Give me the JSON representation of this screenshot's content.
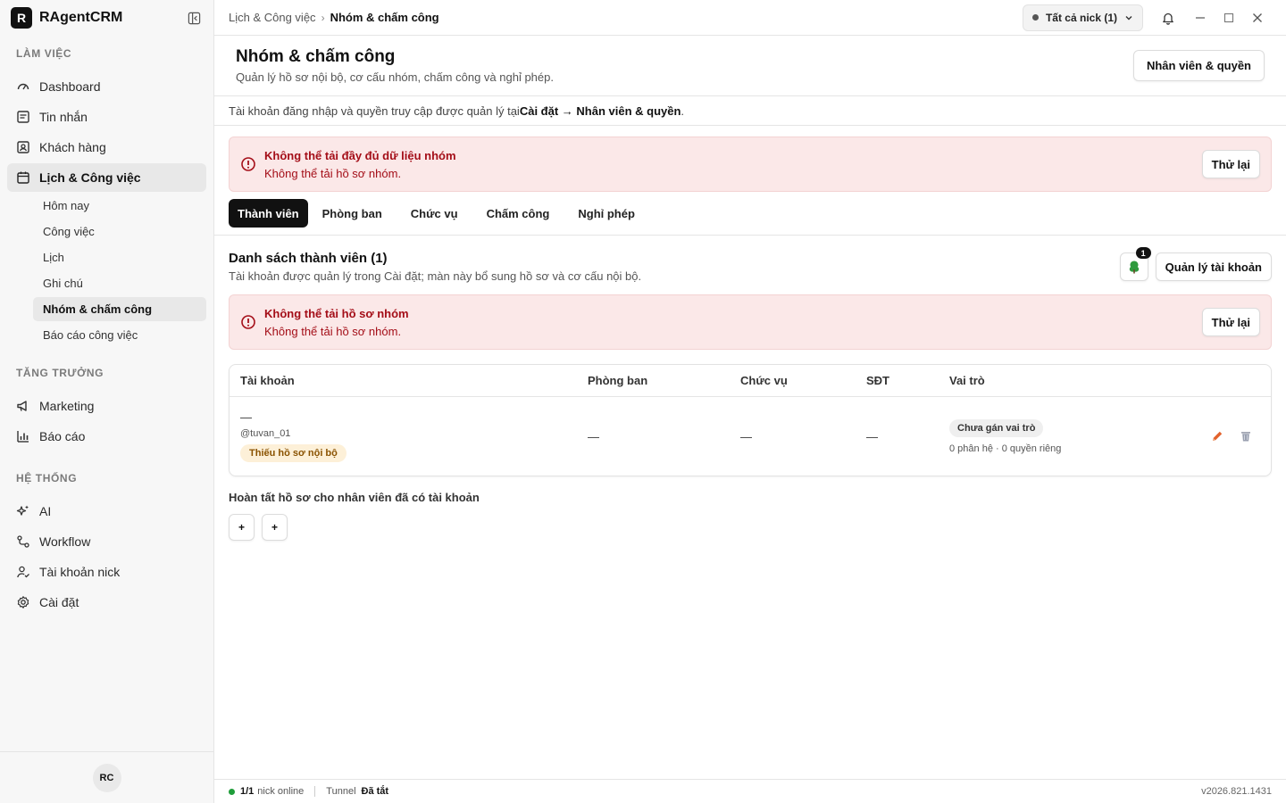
{
  "app": {
    "logo_letter": "R",
    "name": "RAgentCRM"
  },
  "sidebar": {
    "sections": [
      {
        "title": "LÀM VIỆC"
      },
      {
        "title": "TĂNG TRƯỞNG"
      },
      {
        "title": "HỆ THỐNG"
      }
    ],
    "items": {
      "dashboard": "Dashboard",
      "messages": "Tin nhắn",
      "customers": "Khách hàng",
      "schedule": "Lịch & Công việc",
      "marketing": "Marketing",
      "reports": "Báo cáo",
      "ai": "AI",
      "workflow": "Workflow",
      "nick_accounts": "Tài khoản nick",
      "settings": "Cài đặt"
    },
    "sub_items": {
      "today": "Hôm nay",
      "tasks": "Công việc",
      "calendar": "Lịch",
      "notes": "Ghi chú",
      "team": "Nhóm & chấm công",
      "work_report": "Báo cáo công việc"
    },
    "avatar_initials": "RC"
  },
  "topbar": {
    "breadcrumb_parent": "Lịch & Công việc",
    "breadcrumb_sep": "›",
    "breadcrumb_current": "Nhóm & chấm công",
    "nick_filter": "Tất cả nick (1)"
  },
  "page": {
    "title": "Nhóm & chấm công",
    "subtitle": "Quản lý hồ sơ nội bộ, cơ cấu nhóm, chấm công và nghỉ phép.",
    "header_button": "Nhân viên & quyền",
    "info_prefix": "Tài khoản đăng nhập và quyền truy cập được quản lý tại ",
    "info_link": "Cài đặt → Nhân viên & quyền",
    "info_suffix": "."
  },
  "alerts": {
    "top": {
      "title": "Không thể tải đầy đủ dữ liệu nhóm",
      "desc": "Không thể tải hồ sơ nhóm.",
      "button": "Thử lại"
    },
    "members": {
      "title": "Không thể tải hồ sơ nhóm",
      "desc": "Không thể tải hồ sơ nhóm.",
      "button": "Thử lại"
    }
  },
  "tabs": [
    "Thành viên",
    "Phòng ban",
    "Chức vụ",
    "Chấm công",
    "Nghỉ phép"
  ],
  "members": {
    "title": "Danh sách thành viên (1)",
    "subtitle": "Tài khoản được quản lý trong Cài đặt; màn này bổ sung hồ sơ và cơ cấu nội bộ.",
    "tree_badge": "1",
    "manage_button": "Quản lý tài khoản",
    "columns": [
      "Tài khoản",
      "Phòng ban",
      "Chức vụ",
      "SĐT",
      "Vai trò"
    ],
    "rows": [
      {
        "name": "—",
        "username": "@tuvan_01",
        "warning": "Thiếu hồ sơ nội bộ",
        "department": "—",
        "position": "—",
        "phone": "—",
        "role": "Chưa gán vai trò",
        "role_meta": "0 phân hệ · 0 quyền riêng"
      }
    ]
  },
  "complete_section": {
    "title": "Hoàn tất hồ sơ cho nhân viên đã có tài khoản",
    "buttons": [
      "+",
      "+"
    ]
  },
  "statusbar": {
    "online_count": "1/1",
    "online_label": "nick online",
    "tunnel_label": "Tunnel",
    "tunnel_status": "Đã tắt",
    "version": "v2026.821.1431"
  },
  "colors": {
    "error": "#a40e18",
    "online": "#1f9d3a",
    "edit": "#e2622c"
  }
}
